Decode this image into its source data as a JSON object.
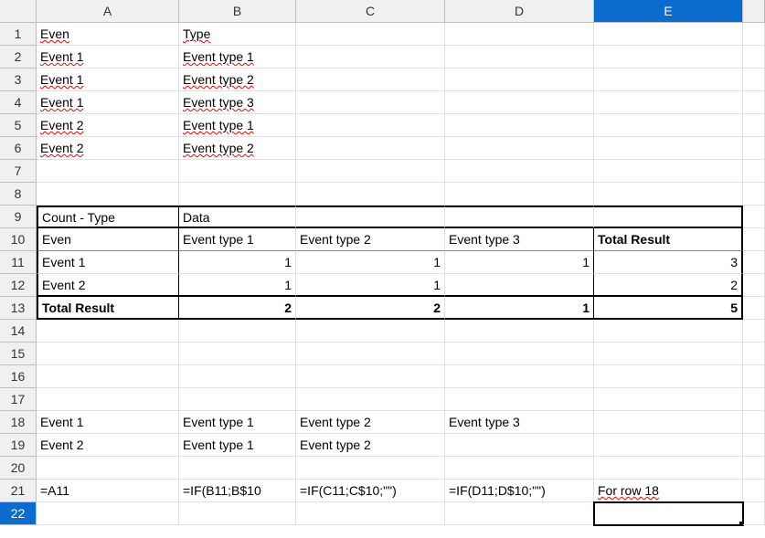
{
  "columns": [
    "",
    "A",
    "B",
    "C",
    "D",
    "E",
    ""
  ],
  "selected_col_index": 5,
  "selected_row_index": 22,
  "rows": {
    "1": {
      "A": "Even",
      "B": "Type"
    },
    "2": {
      "A": "Event 1",
      "B": "Event type 1"
    },
    "3": {
      "A": "Event 1",
      "B": "Event type 2"
    },
    "4": {
      "A": "Event 1",
      "B": "Event type 3"
    },
    "5": {
      "A": "Event 2",
      "B": "Event type 1"
    },
    "6": {
      "A": "Event 2",
      "B": "Event type 2"
    },
    "7": {},
    "8": {},
    "9": {
      "A": "Count - Type",
      "B": "Data"
    },
    "10": {
      "A": "Even",
      "B": "Event type 1",
      "C": "Event type 2",
      "D": "Event type 3",
      "E": "Total Result"
    },
    "11": {
      "A": "Event 1",
      "B": "1",
      "C": "1",
      "D": "1",
      "E": "3"
    },
    "12": {
      "A": "Event 2",
      "B": "1",
      "C": "1",
      "D": "",
      "E": "2"
    },
    "13": {
      "A": "Total Result",
      "B": "2",
      "C": "2",
      "D": "1",
      "E": "5"
    },
    "14": {},
    "15": {},
    "16": {},
    "17": {},
    "18": {
      "A": "Event 1",
      "B": "Event type 1",
      "C": "Event type 2",
      "D": "Event type 3"
    },
    "19": {
      "A": "Event 2",
      "B": "Event type 1",
      "C": "Event type 2"
    },
    "20": {},
    "21": {
      "A": "=A11",
      "B": "=IF(B11;B$10",
      "C": "=IF(C11;C$10;\"\")",
      "D": "=IF(D11;D$10;\"\")",
      "E": "For row 18"
    },
    "22": {}
  },
  "chart_data": {
    "type": "table",
    "title": "Count - Type / Data",
    "columns": [
      "Even",
      "Event type 1",
      "Event type 2",
      "Event type 3",
      "Total Result"
    ],
    "rows": [
      {
        "Even": "Event 1",
        "Event type 1": 1,
        "Event type 2": 1,
        "Event type 3": 1,
        "Total Result": 3
      },
      {
        "Even": "Event 2",
        "Event type 1": 1,
        "Event type 2": 1,
        "Event type 3": null,
        "Total Result": 2
      },
      {
        "Even": "Total Result",
        "Event type 1": 2,
        "Event type 2": 2,
        "Event type 3": 1,
        "Total Result": 5
      }
    ]
  }
}
